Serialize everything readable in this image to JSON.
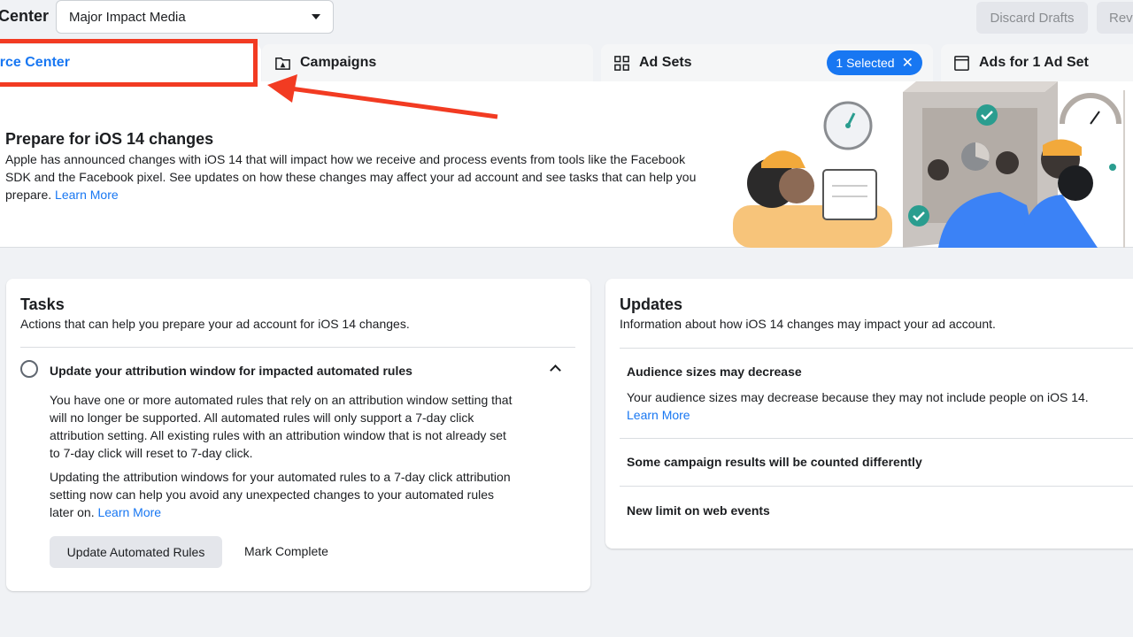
{
  "header": {
    "app_title": "Center",
    "account_selected": "Major Impact Media",
    "discard_label": "Discard Drafts",
    "review_label": "Revi"
  },
  "tabs": [
    {
      "label": "urce Center",
      "icon": "document-icon"
    },
    {
      "label": "Campaigns",
      "icon": "folder-icon"
    },
    {
      "label": "Ad Sets",
      "icon": "grid-icon",
      "badge": "1 Selected"
    },
    {
      "label": "Ads for 1 Ad Set",
      "icon": "window-icon"
    }
  ],
  "banner": {
    "title": "Prepare for iOS 14 changes",
    "text": "Apple has announced changes with iOS 14 that will impact how we receive and process events from tools like the Facebook SDK and the Facebook pixel. See updates on how these changes may affect your ad account and see tasks that can help you prepare.",
    "link": "Learn More"
  },
  "tasks": {
    "title": "Tasks",
    "subtitle": "Actions that can help you prepare your ad account for iOS 14 changes.",
    "item_title": "Update your attribution window for impacted automated rules",
    "para1": "You have one or more automated rules that rely on an attribution window setting that will no longer be supported. All automated rules will only support a 7-day click attribution setting. All existing rules with an attribution window that is not already set to 7-day click will reset to 7-day click.",
    "para2": "Updating the attribution windows for your automated rules to a 7-day click attribution setting now can help you avoid any unexpected changes to your automated rules later on.",
    "link": "Learn More",
    "primary_button": "Update Automated Rules",
    "secondary_button": "Mark Complete"
  },
  "updates": {
    "title": "Updates",
    "subtitle": "Information about how iOS 14 changes may impact your ad account.",
    "items": [
      {
        "title": "Audience sizes may decrease",
        "text": "Your audience sizes may decrease because they may not include people on iOS 14.",
        "link": "Learn More"
      },
      {
        "title": "Some campaign results will be counted differently"
      },
      {
        "title": "New limit on web events"
      }
    ]
  },
  "colors": {
    "accent": "#1877f2",
    "annotation": "#f23b22",
    "page_bg": "#f0f2f5"
  }
}
